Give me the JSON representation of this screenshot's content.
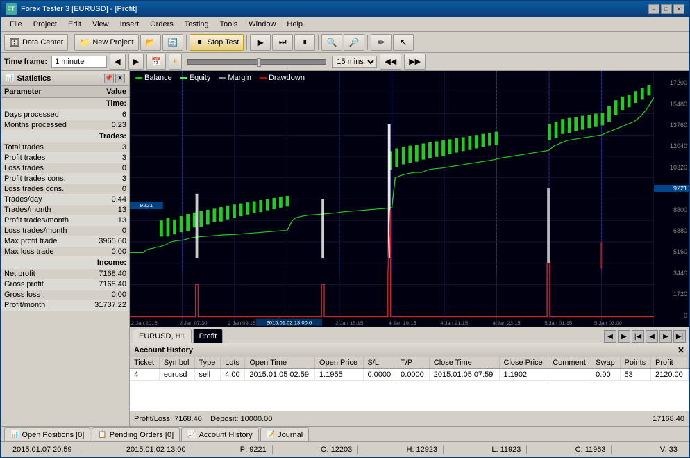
{
  "titleBar": {
    "title": "Forex Tester 3 [EURUSD] - [Profit]",
    "minBtn": "–",
    "maxBtn": "□",
    "closeBtn": "✕"
  },
  "menu": {
    "items": [
      "File",
      "Project",
      "Edit",
      "View",
      "Insert",
      "Orders",
      "Testing",
      "Tools",
      "Window",
      "Help"
    ]
  },
  "toolbar": {
    "dataCenterLabel": "Data Center",
    "newProjectLabel": "New Project",
    "stopTestLabel": "Stop Test",
    "timeframeLabel": "Time frame:",
    "timeframeValue": "1 minute",
    "sliderTime": "15 mins"
  },
  "statistics": {
    "title": "Statistics",
    "columns": [
      "Parameter",
      "Value"
    ],
    "sections": [
      {
        "header": "Time:",
        "rows": [
          [
            "Days processed",
            "6"
          ],
          [
            "Months processed",
            "0.23"
          ]
        ]
      },
      {
        "header": "Trades:",
        "rows": [
          [
            "Total trades",
            "3"
          ],
          [
            "Profit trades",
            "3"
          ],
          [
            "Loss trades",
            "0"
          ],
          [
            "Profit trades cons.",
            "3"
          ],
          [
            "Loss trades cons.",
            "0"
          ],
          [
            "Trades/day",
            "0.44"
          ],
          [
            "Trades/month",
            "13"
          ],
          [
            "Profit trades/month",
            "13"
          ],
          [
            "Loss trades/month",
            "0"
          ],
          [
            "Max profit trade",
            "3965.60"
          ],
          [
            "Max loss trade",
            "0.00"
          ]
        ]
      },
      {
        "header": "Income:",
        "rows": [
          [
            "Net profit",
            "7168.40"
          ],
          [
            "Gross profit",
            "7168.40"
          ],
          [
            "Gross loss",
            "0.00"
          ],
          [
            "Profit/month",
            "31737.22"
          ]
        ]
      }
    ]
  },
  "chartLegend": {
    "items": [
      {
        "label": "Balance",
        "color": "#00cc00"
      },
      {
        "label": "Equity",
        "color": "#44ff44"
      },
      {
        "label": "Margin",
        "color": "#888888"
      },
      {
        "label": "Drawdown",
        "color": "#cc0000"
      }
    ]
  },
  "chartTabs": {
    "tabs": [
      "EURUSD, H1",
      "Profit"
    ],
    "activeTab": "Profit"
  },
  "chartYAxis": {
    "values": [
      "17200",
      "15480",
      "13760",
      "12040",
      "10320",
      "9221",
      "8800",
      "6880",
      "5160",
      "3440",
      "1720",
      "0"
    ]
  },
  "chartXAxis": {
    "values": [
      "2 Jan 2015",
      "2 Jan 07:30",
      "2 Jan 09:15",
      "2015.01.02 13:00:0",
      "2 Jan 15:15",
      "4 Jan 19:15",
      "4 Jan 21:15",
      "4 Jan 23:15",
      "5 Jan 01:15",
      "5 Jan 03:00"
    ]
  },
  "accountHistory": {
    "title": "Account History",
    "columns": [
      "Ticket",
      "Symbol",
      "Type",
      "Lots",
      "Open Time",
      "Open Price",
      "S/L",
      "T/P",
      "Close Time",
      "Close Price",
      "Comment",
      "Swap",
      "Points",
      "Profit"
    ],
    "rows": [
      {
        "ticket": "4",
        "symbol": "eurusd",
        "type": "sell",
        "lots": "4.00",
        "openTime": "2015.01.05 02:59",
        "openPrice": "1.1955",
        "sl": "0.0000",
        "tp": "0.0000",
        "closeTime": "2015.01.05 07:59",
        "closePrice": "1.1902",
        "comment": "",
        "swap": "0.00",
        "points": "53",
        "profit": "2120.00"
      }
    ],
    "footer": {
      "profitLoss": "Profit/Loss: 7168.40",
      "deposit": "Deposit: 10000.00",
      "balance": "17168.40"
    }
  },
  "bottomTabs": [
    {
      "label": "Open Positions [0]",
      "icon": "📊"
    },
    {
      "label": "Pending Orders [0]",
      "icon": "📋"
    },
    {
      "label": "Account History",
      "icon": "📈"
    },
    {
      "label": "Journal",
      "icon": "📝"
    }
  ],
  "statusBar": {
    "datetime": "2015.01.07 20:59",
    "chartTime": "2015.01.02 13:00",
    "price": "P: 9221",
    "open": "O: 12203",
    "high": "H: 12923",
    "low": "L: 11923",
    "close": "C: 11963",
    "volume": "V: 33"
  }
}
